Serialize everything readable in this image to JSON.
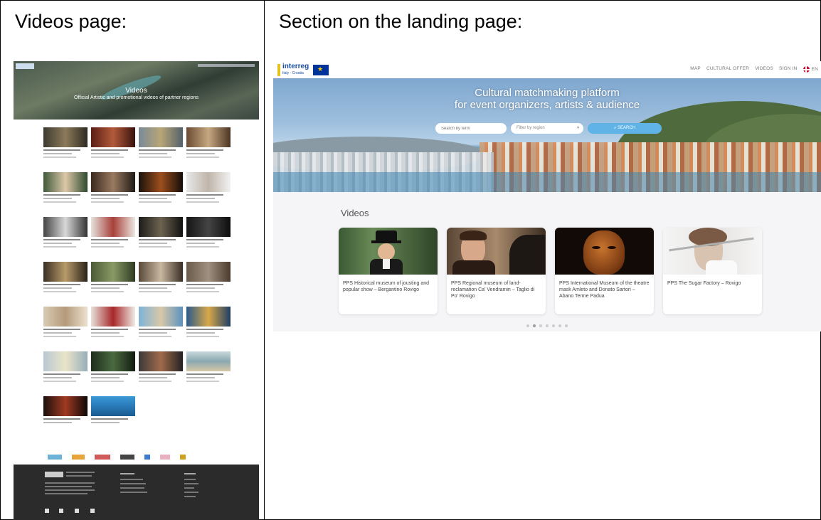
{
  "panels": {
    "left_title": "Videos page:",
    "right_title": "Section on the landing page:"
  },
  "videos_page": {
    "hero_title": "Videos",
    "hero_subtitle": "Official Artistic and promotional videos of partner regions"
  },
  "landing": {
    "nav": {
      "logo_text": "interreg",
      "logo_sub": "Italy - Croatia",
      "items": [
        "MAP",
        "CULTURAL OFFER",
        "VIDEOS",
        "SIGN IN",
        "EN"
      ]
    },
    "hero": {
      "title_line1": "Cultural matchmaking platform",
      "title_line2": "for event organizers, artists & audience",
      "search_placeholder": "Search by term",
      "region_placeholder": "Filter by region",
      "search_button": "SEARCH"
    },
    "videos_heading": "Videos",
    "cards": [
      {
        "title": "PPS Historical museum of jousting and popular show – Bergantino Rovigo"
      },
      {
        "title": "PPS Regional museum of land-reclamation Ca' Vendramin – Taglio di Po' Rovigo"
      },
      {
        "title": "PPS International Museum of the theatre mask Amleto and Donato Sartori – Abano Terme Padua"
      },
      {
        "title": "PPS The Sugar Factory – Rovigo"
      }
    ],
    "colors": {
      "accent": "#5fb3e6",
      "nav_text": "#777777"
    }
  }
}
